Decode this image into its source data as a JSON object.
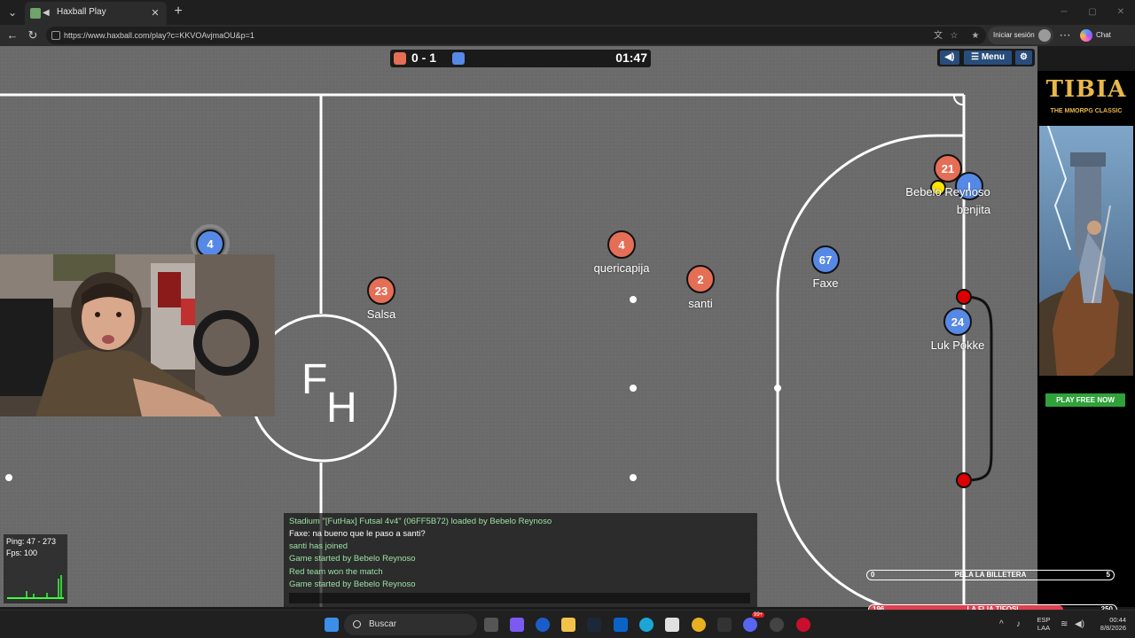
{
  "browser": {
    "tab_title": "Haxball Play",
    "url": "https://www.haxball.com/play?c=KKVOAvjmaOU&p=1",
    "signin_label": "Iniciar sesión",
    "chat_label": "Chat"
  },
  "game": {
    "score": "0 - 1",
    "timer": "01:47",
    "menu_label": "Menu",
    "center_logo_top": "F",
    "center_logo_bottom": "H",
    "players": [
      {
        "number": "4",
        "team": "blue",
        "name": ""
      },
      {
        "number": "23",
        "team": "red",
        "name": "Salsa"
      },
      {
        "number": "4",
        "team": "red",
        "name": "quericapija"
      },
      {
        "number": "2",
        "team": "red",
        "name": "santi"
      },
      {
        "number": "67",
        "team": "blue",
        "name": "Faxe"
      },
      {
        "number": "21",
        "team": "red",
        "name": "Bebelo Reynoso"
      },
      {
        "number": "I",
        "team": "blue",
        "name": "benjita"
      },
      {
        "number": "24",
        "team": "blue",
        "name": "Luk Pokke"
      }
    ],
    "colors": {
      "red_team": "#e56e56",
      "blue_team": "#5689e5",
      "field": "#6b6b6b",
      "ball": "#ffe500"
    }
  },
  "stats": {
    "ping": "Ping: 47 - 273",
    "fps": "Fps: 100"
  },
  "chat": {
    "lines": [
      {
        "text": "Stadium \"[FutHax] Futsal 4v4\" (06FF5B72) loaded by Bebelo Reynoso",
        "color": "#9be0a4"
      },
      {
        "text": "Faxe: na bueno que le paso a santi?",
        "color": "#ffffff"
      },
      {
        "text": "santi has joined",
        "color": "#9be0a4"
      },
      {
        "text": "Game started by Bebelo Reynoso",
        "color": "#9be0a4"
      },
      {
        "text": "Red team won the match",
        "color": "#9be0a4"
      },
      {
        "text": "Game started by Bebelo Reynoso",
        "color": "#9be0a4"
      }
    ]
  },
  "ad": {
    "title": "TIBIA",
    "subtitle": "THE MMORPG CLASSIC",
    "cta": "PLAY FREE NOW"
  },
  "stream_bars": [
    {
      "left": "0",
      "label": "PELA LA BILLETERA",
      "right": "5",
      "progress": 0
    },
    {
      "left": "196",
      "label": "LA FLIA TIFOSI",
      "right": "250",
      "progress": 0.784
    }
  ],
  "taskbar": {
    "search_placeholder": "Buscar",
    "lang_top": "ESP",
    "lang_bottom": "LAA",
    "time": "00:44",
    "date": "8/8/2026",
    "discord_badge": "99+"
  }
}
